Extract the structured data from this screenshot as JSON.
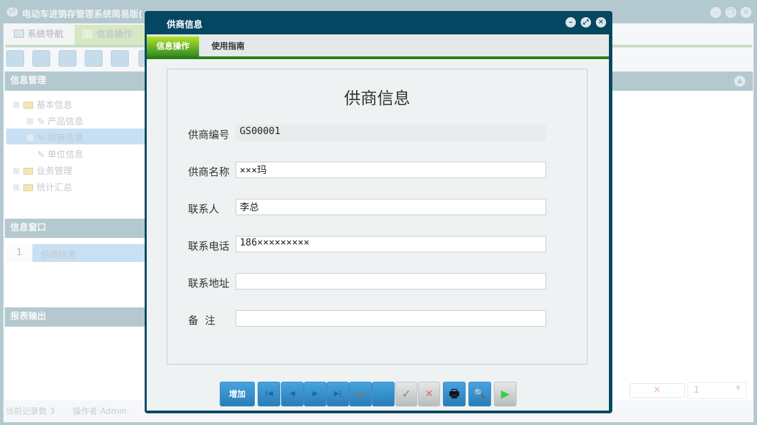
{
  "app": {
    "title": "电动车进销存管理系统简易版(",
    "logo": "yF"
  },
  "main_tabs": [
    {
      "label": "系统导航"
    },
    {
      "label": "信息操作"
    }
  ],
  "left": {
    "info_mgmt": "信息管理",
    "tree": [
      {
        "label": "基本信息"
      },
      {
        "label": "产品信息"
      },
      {
        "label": "供商信息"
      },
      {
        "label": "单位信息"
      },
      {
        "label": "业务管理"
      },
      {
        "label": "统计汇总"
      }
    ],
    "info_window": "信息窗口",
    "window_rows": [
      {
        "num": "1",
        "label": "供商信息"
      }
    ],
    "report": "报表输出"
  },
  "status": {
    "records": "当前记录数 3",
    "operator": "操作者:Admin"
  },
  "right": {
    "page_select": "1"
  },
  "dialog": {
    "title": "供商信息",
    "tabs": [
      {
        "label": "信息操作"
      },
      {
        "label": "使用指南"
      }
    ],
    "form_title": "供商信息",
    "fields": [
      {
        "label": "供商编号",
        "value": "GS00001"
      },
      {
        "label": "供商名称",
        "value": "×××玛"
      },
      {
        "label": "联系人",
        "value": "李总"
      },
      {
        "label": "联系电话",
        "value": "186×××××××××"
      },
      {
        "label": "联系地址",
        "value": ""
      },
      {
        "label": "备  注",
        "value": ""
      }
    ],
    "buttons": {
      "add": "增加",
      "first": "|◀",
      "prev": "◀",
      "next": "▶",
      "last": "▶|",
      "delete": "—",
      "up": "▲",
      "confirm": "✓",
      "cancel": "✕",
      "print": "🖶",
      "preview": "🔍",
      "run": "▶"
    }
  },
  "colors": {
    "dialog": "#034762",
    "accent_green": "#2c7d12",
    "button_blue": "#3a8fc8"
  }
}
